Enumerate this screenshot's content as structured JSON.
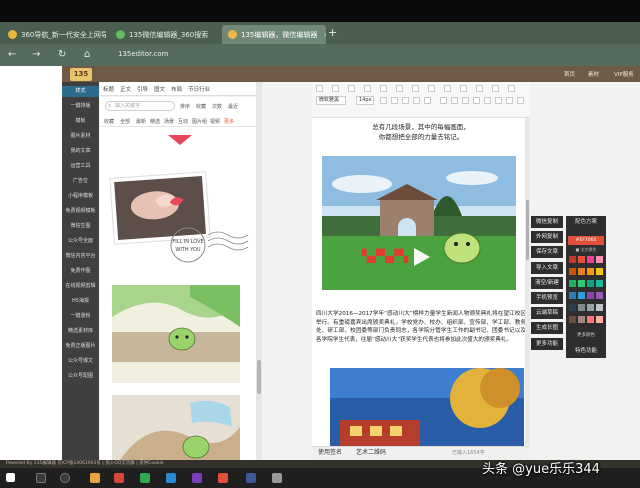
{
  "browser": {
    "tabs": [
      {
        "label": "360导航_新一代安全上网导",
        "icon_color": "#e8b93c",
        "active": false
      },
      {
        "label": "135微信编辑器_360搜索",
        "icon_color": "#5fbf5f",
        "active": false
      },
      {
        "label": "135编辑器，微信编辑器",
        "icon_color": "#f0b54a",
        "active": true
      }
    ],
    "add_tab": "+",
    "nav": {
      "back": "←",
      "forward": "→",
      "refresh": "↻",
      "home": "⌂"
    },
    "url": "135editor.com"
  },
  "app": {
    "logo": "135",
    "topbar_items": [
      "首页",
      "素材",
      "VIP服务"
    ],
    "left_nav": [
      {
        "label": "样式",
        "highlight": true
      },
      {
        "label": "一键排版",
        "highlight": false
      },
      {
        "label": "模板",
        "highlight": false
      },
      {
        "label": "图片素材",
        "highlight": false
      },
      {
        "label": "我的文章",
        "highlight": false
      },
      {
        "label": "运营工具",
        "highlight": false
      },
      {
        "label": "广告位",
        "highlight": false
      },
      {
        "label": "小程序模板",
        "highlight": false
      },
      {
        "label": "免费视频模板",
        "highlight": false
      },
      {
        "label": "微信生图",
        "highlight": false
      },
      {
        "label": "公众号全面",
        "highlight": false
      },
      {
        "label": "微信内容平台",
        "highlight": false
      },
      {
        "label": "免费作图",
        "highlight": false
      },
      {
        "label": "在线视频剪辑",
        "highlight": false
      },
      {
        "label": "H5海报",
        "highlight": false
      },
      {
        "label": "一键涨粉",
        "highlight": false
      },
      {
        "label": "精选素材库",
        "highlight": false
      },
      {
        "label": "免费正版图片",
        "highlight": false
      },
      {
        "label": "公众号爆文",
        "highlight": false
      },
      {
        "label": "公众号配图",
        "highlight": false
      }
    ],
    "style_tabs": [
      "标题",
      "正文",
      "引导",
      "图文",
      "布局",
      "节日行业"
    ],
    "search_placeholder": "输入关键字",
    "filters": [
      "排序",
      "收藏",
      "次数",
      "最近"
    ],
    "sub_filters": [
      "收藏",
      "全部",
      "最新",
      "精选",
      "场景",
      "互动",
      "图片组",
      "视频",
      "更多"
    ],
    "style_card": {
      "text1": "FILL IN LOVE",
      "text2": "WITH YOU"
    }
  },
  "editor": {
    "font_select": "微软雅黑",
    "size_select": "14px",
    "lines_top": [
      "总有几段场景，其中的每幅画面，",
      "你都想把全部的力量去铭记。"
    ],
    "paragraph": "四川大学2016—2017学年“感动川大”榜样力量学生新闻人物颁奖典礼将在望江校区举行。有重磅嘉宾出席颁奖典礼，学校党办、校办、组织部、宣传部、学工部、教务处、研工部、校团委等部门负责同志，各学院分管学生工作的副书记、团委书记以及各学院学生代表，往届“感动川大”获奖学生代表也将参加此次盛大的颁奖典礼。",
    "footer_tabs": [
      "使用签名",
      "艺术二维码"
    ],
    "word_count": "已输入1654字"
  },
  "right_panel": {
    "buttons": [
      "微信复制",
      "外网复制",
      "保存文章",
      "导入文章",
      "清空/新建",
      "手机预览",
      "云端草稿",
      "生成长图",
      "更多功能"
    ],
    "palette": {
      "title": "配色方案",
      "hex": "#EF7060",
      "sub": "■ 全文换色",
      "more": "更多颜色",
      "colors": [
        "#c0392b",
        "#e74c3c",
        "#e84393",
        "#f78fb3",
        "#d35400",
        "#e67e22",
        "#f39c12",
        "#f1c40f",
        "#27ae60",
        "#2ecc71",
        "#16a085",
        "#1abc9c",
        "#2980b9",
        "#3498db",
        "#8e44ad",
        "#9b59b6",
        "#2c3e50",
        "#7f8c8d",
        "#95a5a6",
        "#bdc3c7",
        "#6d4c41",
        "#a1887f",
        "#ff7675",
        "#fab1a0"
      ]
    },
    "special": "特色功能"
  },
  "status_bar": "Powered By 135编辑器 京ICP备14061903号 | 加入QQ交流群 | 提供Cookie",
  "watermark": "头条 @yue乐乐344"
}
